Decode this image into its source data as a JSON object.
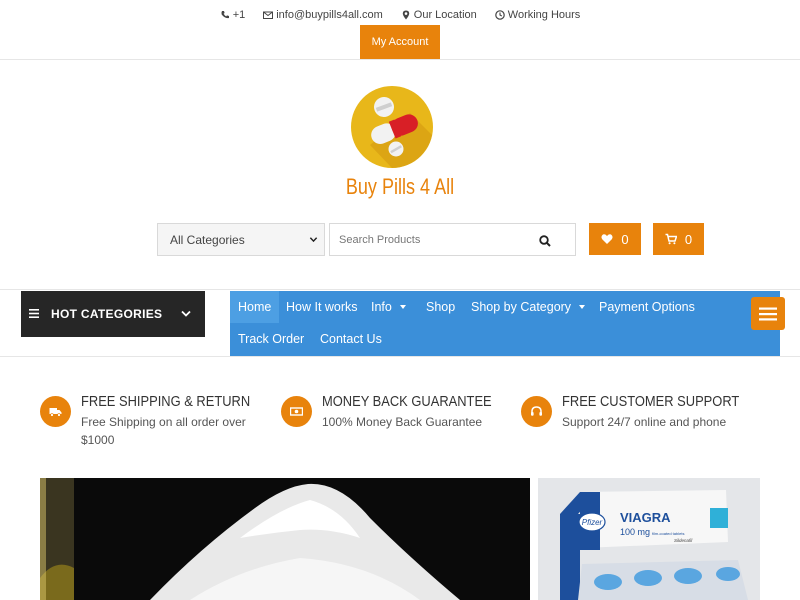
{
  "topbar": {
    "phone": "+1",
    "email": "info@buypills4all.com",
    "location": "Our Location",
    "hours": "Working Hours",
    "account_label": "My Account"
  },
  "site": {
    "title": "Buy Pills 4 All"
  },
  "search": {
    "category_selected": "All Categories",
    "placeholder": "Search Products"
  },
  "header_buttons": {
    "wishlist_count": "0",
    "cart_count": "0"
  },
  "hot_categories": {
    "label": "HOT CATEGORIES"
  },
  "nav": {
    "items": [
      {
        "label": "Home"
      },
      {
        "label": "How It works"
      },
      {
        "label": "Info"
      },
      {
        "label": "Shop"
      },
      {
        "label": "Shop by Category"
      },
      {
        "label": "Payment Options"
      },
      {
        "label": "Track Order"
      },
      {
        "label": "Contact Us"
      }
    ]
  },
  "features": [
    {
      "title": "FREE SHIPPING & RETURN",
      "desc_line1": "Free Shipping on all order over",
      "desc_line2": "$1000",
      "icon": "truck-icon"
    },
    {
      "title": "MONEY BACK GUARANTEE",
      "desc_line1": "100% Money Back Guarantee",
      "desc_line2": "",
      "icon": "money-icon"
    },
    {
      "title": "FREE CUSTOMER SUPPORT",
      "desc_line1": "Support 24/7 online and phone",
      "desc_line2": "",
      "icon": "headset-icon"
    }
  ],
  "banner_side": {
    "brand": "VIAGRA",
    "dose": "100 mg",
    "maker": "Pfizer",
    "subtitle": "film-coated tablets",
    "generic": "Sildenafil"
  },
  "colors": {
    "accent": "#e8830c",
    "nav_blue": "#3b8fd9",
    "dark": "#262626"
  }
}
